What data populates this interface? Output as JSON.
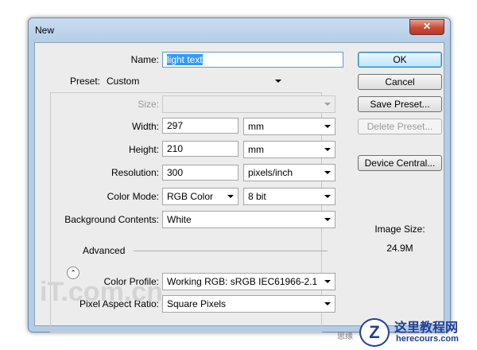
{
  "dialog": {
    "title": "New",
    "close_glyph": "✕"
  },
  "form": {
    "name_label": "Name:",
    "name_value": "light text",
    "preset_label": "Preset:",
    "preset_value": "Custom",
    "size_label": "Size:",
    "size_value": "",
    "width_label": "Width:",
    "width_value": "297",
    "width_unit": "mm",
    "height_label": "Height:",
    "height_value": "210",
    "height_unit": "mm",
    "resolution_label": "Resolution:",
    "resolution_value": "300",
    "resolution_unit": "pixels/inch",
    "color_mode_label": "Color Mode:",
    "color_mode_value": "RGB Color",
    "bit_depth_value": "8 bit",
    "background_label": "Background Contents:",
    "background_value": "White",
    "advanced_label": "Advanced",
    "advanced_icon": "chevron-up-icon",
    "color_profile_label": "Color Profile:",
    "color_profile_value": "Working RGB:  sRGB IEC61966-2.1",
    "pixel_aspect_label": "Pixel Aspect Ratio:",
    "pixel_aspect_value": "Square Pixels"
  },
  "buttons": {
    "ok": "OK",
    "cancel": "Cancel",
    "save_preset": "Save Preset...",
    "delete_preset": "Delete Preset...",
    "device_central": "Device Central..."
  },
  "image_size": {
    "label": "Image Size:",
    "value": "24.9M"
  },
  "watermarks": {
    "left": "iT.com.cn",
    "site_name": "这里教程网",
    "site_url": "herecours.com",
    "partial": "思缘"
  },
  "colors": {
    "accent_selection": "#3399ff",
    "default_button": "#bee6fd",
    "close_button": "#c94b37"
  }
}
